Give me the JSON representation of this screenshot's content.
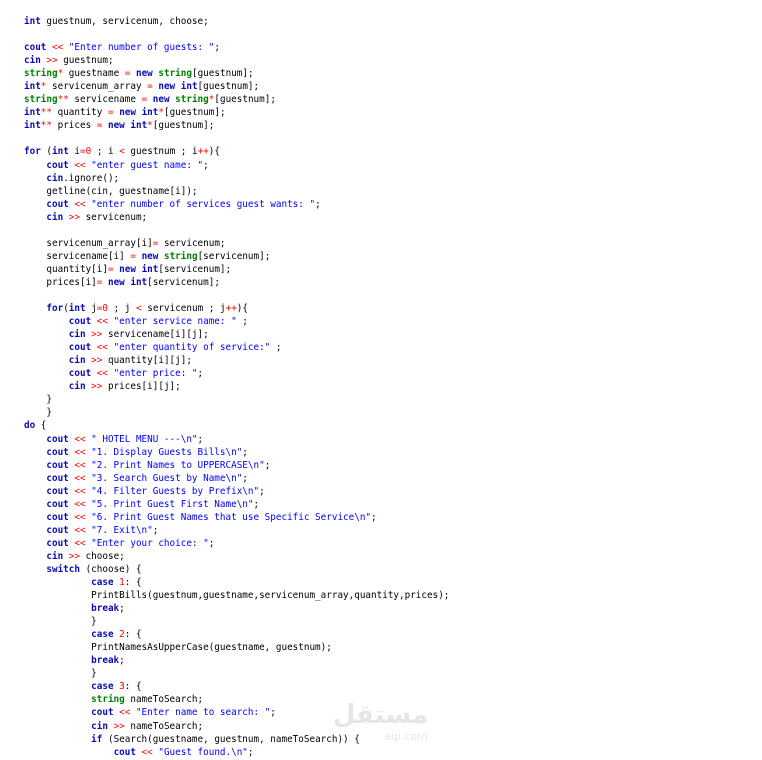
{
  "code_lines": [
    [
      [
        "kw",
        "int"
      ],
      [
        "id",
        " guestnum, servicenum, choose;"
      ]
    ],
    [],
    [
      [
        "kw",
        "cout"
      ],
      [
        "op",
        " << "
      ],
      [
        "str",
        "\"Enter number of guests: \""
      ],
      [
        "id",
        ";"
      ]
    ],
    [
      [
        "kw",
        "cin"
      ],
      [
        "op",
        " >> "
      ],
      [
        "id",
        "guestnum;"
      ]
    ],
    [
      [
        "typ",
        "string"
      ],
      [
        "op",
        "*"
      ],
      [
        "id",
        " guestname "
      ],
      [
        "op",
        "="
      ],
      [
        "kw",
        " new "
      ],
      [
        "typ",
        "string"
      ],
      [
        "id",
        "[guestnum];"
      ]
    ],
    [
      [
        "kw",
        "int"
      ],
      [
        "op",
        "*"
      ],
      [
        "id",
        " servicenum_array "
      ],
      [
        "op",
        "="
      ],
      [
        "kw",
        " new int"
      ],
      [
        "id",
        "[guestnum];"
      ]
    ],
    [
      [
        "typ",
        "string"
      ],
      [
        "op",
        "**"
      ],
      [
        "id",
        " servicename "
      ],
      [
        "op",
        "="
      ],
      [
        "kw",
        " new "
      ],
      [
        "typ",
        "string"
      ],
      [
        "op",
        "*"
      ],
      [
        "id",
        "[guestnum];"
      ]
    ],
    [
      [
        "kw",
        "int"
      ],
      [
        "op",
        "**"
      ],
      [
        "id",
        " quantity "
      ],
      [
        "op",
        "="
      ],
      [
        "kw",
        " new int"
      ],
      [
        "op",
        "*"
      ],
      [
        "id",
        "[guestnum];"
      ]
    ],
    [
      [
        "kw",
        "int"
      ],
      [
        "op",
        "**"
      ],
      [
        "id",
        " prices "
      ],
      [
        "op",
        "="
      ],
      [
        "kw",
        " new int"
      ],
      [
        "op",
        "*"
      ],
      [
        "id",
        "[guestnum];"
      ]
    ],
    [],
    [
      [
        "kw",
        "for"
      ],
      [
        "id",
        " ("
      ],
      [
        "kw",
        "int"
      ],
      [
        "id",
        " i"
      ],
      [
        "op",
        "="
      ],
      [
        "num",
        "0"
      ],
      [
        "id",
        " ; i "
      ],
      [
        "op",
        "<"
      ],
      [
        "id",
        " guestnum ; i"
      ],
      [
        "op",
        "++"
      ],
      [
        "id",
        "){"
      ]
    ],
    [
      [
        "id",
        "    "
      ],
      [
        "kw",
        "cout"
      ],
      [
        "op",
        " << "
      ],
      [
        "str",
        "\"enter guest name: \""
      ],
      [
        "id",
        ";"
      ]
    ],
    [
      [
        "id",
        "    "
      ],
      [
        "kw",
        "cin"
      ],
      [
        "id",
        ".ignore();"
      ]
    ],
    [
      [
        "id",
        "    getline(cin, guestname[i]);"
      ]
    ],
    [
      [
        "id",
        "    "
      ],
      [
        "kw",
        "cout"
      ],
      [
        "op",
        " << "
      ],
      [
        "str",
        "\"enter number of services guest wants: \""
      ],
      [
        "id",
        ";"
      ]
    ],
    [
      [
        "id",
        "    "
      ],
      [
        "kw",
        "cin"
      ],
      [
        "op",
        " >> "
      ],
      [
        "id",
        "servicenum;"
      ]
    ],
    [],
    [
      [
        "id",
        "    servicenum_array[i]"
      ],
      [
        "op",
        "="
      ],
      [
        "id",
        " servicenum;"
      ]
    ],
    [
      [
        "id",
        "    servicename[i] "
      ],
      [
        "op",
        "="
      ],
      [
        "kw",
        " new "
      ],
      [
        "typ",
        "string"
      ],
      [
        "id",
        "[servicenum];"
      ]
    ],
    [
      [
        "id",
        "    quantity[i]"
      ],
      [
        "op",
        "="
      ],
      [
        "kw",
        " new int"
      ],
      [
        "id",
        "[servicenum];"
      ]
    ],
    [
      [
        "id",
        "    prices[i]"
      ],
      [
        "op",
        "="
      ],
      [
        "kw",
        " new int"
      ],
      [
        "id",
        "[servicenum];"
      ]
    ],
    [],
    [
      [
        "id",
        "    "
      ],
      [
        "kw",
        "for"
      ],
      [
        "id",
        "("
      ],
      [
        "kw",
        "int"
      ],
      [
        "id",
        " j"
      ],
      [
        "op",
        "="
      ],
      [
        "num",
        "0"
      ],
      [
        "id",
        " ; j "
      ],
      [
        "op",
        "<"
      ],
      [
        "id",
        " servicenum ; j"
      ],
      [
        "op",
        "++"
      ],
      [
        "id",
        "){"
      ]
    ],
    [
      [
        "id",
        "        "
      ],
      [
        "kw",
        "cout"
      ],
      [
        "op",
        " << "
      ],
      [
        "str",
        "\"enter service name: \""
      ],
      [
        "id",
        " ;"
      ]
    ],
    [
      [
        "id",
        "        "
      ],
      [
        "kw",
        "cin"
      ],
      [
        "op",
        " >> "
      ],
      [
        "id",
        "servicename[i][j];"
      ]
    ],
    [
      [
        "id",
        "        "
      ],
      [
        "kw",
        "cout"
      ],
      [
        "op",
        " << "
      ],
      [
        "str",
        "\"enter quantity of service:\""
      ],
      [
        "id",
        " ;"
      ]
    ],
    [
      [
        "id",
        "        "
      ],
      [
        "kw",
        "cin"
      ],
      [
        "op",
        " >> "
      ],
      [
        "id",
        "quantity[i][j];"
      ]
    ],
    [
      [
        "id",
        "        "
      ],
      [
        "kw",
        "cout"
      ],
      [
        "op",
        " << "
      ],
      [
        "str",
        "\"enter price: \""
      ],
      [
        "id",
        ";"
      ]
    ],
    [
      [
        "id",
        "        "
      ],
      [
        "kw",
        "cin"
      ],
      [
        "op",
        " >> "
      ],
      [
        "id",
        "prices[i][j];"
      ]
    ],
    [
      [
        "id",
        "    }"
      ]
    ],
    [
      [
        "id",
        "    }"
      ]
    ],
    [
      [
        "kw",
        "do"
      ],
      [
        "id",
        " {"
      ]
    ],
    [
      [
        "id",
        "    "
      ],
      [
        "kw",
        "cout"
      ],
      [
        "op",
        " << "
      ],
      [
        "str",
        "\" HOTEL MENU ---\\n\""
      ],
      [
        "id",
        ";"
      ]
    ],
    [
      [
        "id",
        "    "
      ],
      [
        "kw",
        "cout"
      ],
      [
        "op",
        " << "
      ],
      [
        "str",
        "\"1. Display Guests Bills\\n\""
      ],
      [
        "id",
        ";"
      ]
    ],
    [
      [
        "id",
        "    "
      ],
      [
        "kw",
        "cout"
      ],
      [
        "op",
        " << "
      ],
      [
        "str",
        "\"2. Print Names to UPPERCASE\\n\""
      ],
      [
        "id",
        ";"
      ]
    ],
    [
      [
        "id",
        "    "
      ],
      [
        "kw",
        "cout"
      ],
      [
        "op",
        " << "
      ],
      [
        "str",
        "\"3. Search Guest by Name\\n\""
      ],
      [
        "id",
        ";"
      ]
    ],
    [
      [
        "id",
        "    "
      ],
      [
        "kw",
        "cout"
      ],
      [
        "op",
        " << "
      ],
      [
        "str",
        "\"4. Filter Guests by Prefix\\n\""
      ],
      [
        "id",
        ";"
      ]
    ],
    [
      [
        "id",
        "    "
      ],
      [
        "kw",
        "cout"
      ],
      [
        "op",
        " << "
      ],
      [
        "str",
        "\"5. Print Guest First Name\\n\""
      ],
      [
        "id",
        ";"
      ]
    ],
    [
      [
        "id",
        "    "
      ],
      [
        "kw",
        "cout"
      ],
      [
        "op",
        " << "
      ],
      [
        "str",
        "\"6. Print Guest Names that use Specific Service\\n\""
      ],
      [
        "id",
        ";"
      ]
    ],
    [
      [
        "id",
        "    "
      ],
      [
        "kw",
        "cout"
      ],
      [
        "op",
        " << "
      ],
      [
        "str",
        "\"7. Exit\\n\""
      ],
      [
        "id",
        ";"
      ]
    ],
    [
      [
        "id",
        "    "
      ],
      [
        "kw",
        "cout"
      ],
      [
        "op",
        " << "
      ],
      [
        "str",
        "\"Enter your choice: \""
      ],
      [
        "id",
        ";"
      ]
    ],
    [
      [
        "id",
        "    "
      ],
      [
        "kw",
        "cin"
      ],
      [
        "op",
        " >> "
      ],
      [
        "id",
        "choose;"
      ]
    ],
    [
      [
        "id",
        "    "
      ],
      [
        "kw",
        "switch"
      ],
      [
        "id",
        " (choose) {"
      ]
    ],
    [
      [
        "id",
        "            "
      ],
      [
        "kw",
        "case"
      ],
      [
        "num",
        " 1"
      ],
      [
        "id",
        ": {"
      ]
    ],
    [
      [
        "id",
        "            PrintBills(guestnum,guestname,servicenum_array,quantity,prices);"
      ]
    ],
    [
      [
        "id",
        "            "
      ],
      [
        "kw",
        "break"
      ],
      [
        "id",
        ";"
      ]
    ],
    [
      [
        "id",
        "            }"
      ]
    ],
    [
      [
        "id",
        "            "
      ],
      [
        "kw",
        "case"
      ],
      [
        "num",
        " 2"
      ],
      [
        "id",
        ": {"
      ]
    ],
    [
      [
        "id",
        "            PrintNamesAsUpperCase(guestname, guestnum);"
      ]
    ],
    [
      [
        "id",
        "            "
      ],
      [
        "kw",
        "break"
      ],
      [
        "id",
        ";"
      ]
    ],
    [
      [
        "id",
        "            }"
      ]
    ],
    [
      [
        "id",
        "            "
      ],
      [
        "kw",
        "case"
      ],
      [
        "num",
        " 3"
      ],
      [
        "id",
        ": {"
      ]
    ],
    [
      [
        "id",
        "            "
      ],
      [
        "typ",
        "string"
      ],
      [
        "id",
        " nameToSearch;"
      ]
    ],
    [
      [
        "id",
        "            "
      ],
      [
        "kw",
        "cout"
      ],
      [
        "op",
        " << "
      ],
      [
        "str",
        "\"Enter name to search: \""
      ],
      [
        "id",
        ";"
      ]
    ],
    [
      [
        "id",
        "            "
      ],
      [
        "kw",
        "cin"
      ],
      [
        "op",
        " >> "
      ],
      [
        "id",
        "nameToSearch;"
      ]
    ],
    [
      [
        "id",
        "            "
      ],
      [
        "kw",
        "if"
      ],
      [
        "id",
        " (Search(guestname, guestnum, nameToSearch)) {"
      ]
    ],
    [
      [
        "id",
        "                "
      ],
      [
        "kw",
        "cout"
      ],
      [
        "op",
        " << "
      ],
      [
        "str",
        "\"Guest found.\\n\""
      ],
      [
        "id",
        ";"
      ]
    ]
  ],
  "watermark": {
    "logo_text": "مستقل",
    "url_text": "aqi.com"
  }
}
